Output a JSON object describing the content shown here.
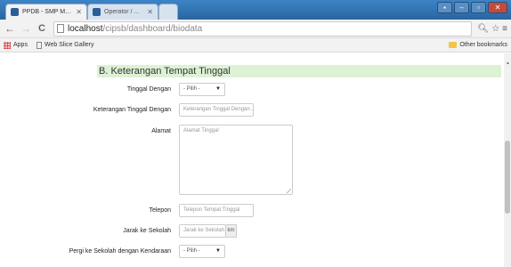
{
  "browser": {
    "tabs": [
      {
        "title": "PPDB - SMP Muhammad",
        "active": true
      },
      {
        "title": "Operator / Administrator",
        "active": false
      }
    ],
    "url_host": "localhost",
    "url_path": "/cipsb/dashboard/biodata",
    "bookmarks": [
      {
        "label": "Apps",
        "icon": "apps-icon"
      },
      {
        "label": "Web Slice Gallery",
        "icon": "page-icon"
      }
    ],
    "other_bookmarks": "Other bookmarks"
  },
  "form": {
    "section_title": "B. Keterangan Tempat Tinggal",
    "tinggal_dengan": {
      "label": "Tinggal Dengan",
      "value": "- Pilih -"
    },
    "keterangan_tinggal": {
      "label": "Keterangan Tinggal Dengan",
      "placeholder": "Keterangan Tinggal Dengan..."
    },
    "alamat": {
      "label": "Alamat",
      "placeholder": "Alamat Tinggal"
    },
    "telepon": {
      "label": "Telepon",
      "placeholder": "Telepon Tempat Tinggal"
    },
    "jarak": {
      "label": "Jarak ke Sekolah",
      "placeholder": "Jarak ke Sekolah",
      "unit": "km"
    },
    "pergi": {
      "label": "Pergi ke Sekolah dengan Kendaraan",
      "value": "- Pilih -"
    }
  },
  "colors": {
    "section_header_bg": "#dcf2d4",
    "titlebar": "#2f6ea8"
  }
}
